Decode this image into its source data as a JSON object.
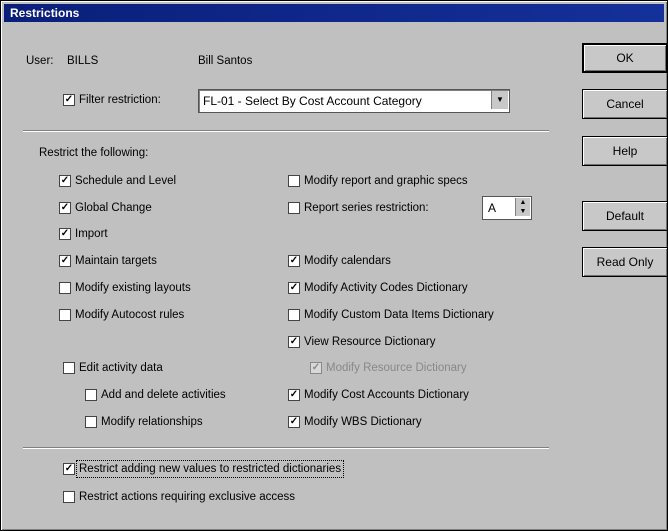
{
  "window": {
    "title": "Restrictions"
  },
  "user": {
    "label": "User:",
    "id": "BILLS",
    "name": "Bill Santos"
  },
  "filter": {
    "label": "Filter restriction:",
    "checked": true,
    "value": "FL-01 - Select By Cost Account Category"
  },
  "restrict_heading": "Restrict the following:",
  "left_checks": [
    {
      "label": "Schedule and Level",
      "checked": true
    },
    {
      "label": "Global Change",
      "checked": true
    },
    {
      "label": "Import",
      "checked": true
    },
    {
      "label": "Maintain targets",
      "checked": true
    },
    {
      "label": "Modify existing layouts",
      "checked": false
    },
    {
      "label": "Modify Autocost rules",
      "checked": false
    },
    {
      "label": "Edit activity data",
      "checked": false
    },
    {
      "label": "Add and delete activities",
      "checked": false
    },
    {
      "label": "Modify relationships",
      "checked": false
    }
  ],
  "right_checks": [
    {
      "label": "Modify report and graphic specs",
      "checked": false
    },
    {
      "label": "Report series restriction:",
      "checked": false
    },
    {
      "label": "Modify calendars",
      "checked": true
    },
    {
      "label": "Modify Activity Codes Dictionary",
      "checked": true
    },
    {
      "label": "Modify Custom Data Items Dictionary",
      "checked": false
    },
    {
      "label": "View Resource Dictionary",
      "checked": true
    },
    {
      "label": "Modify Resource Dictionary",
      "checked": true
    },
    {
      "label": "Modify Cost Accounts Dictionary",
      "checked": true
    },
    {
      "label": "Modify WBS Dictionary",
      "checked": true
    }
  ],
  "report_series_value": "A",
  "bottom_checks": [
    {
      "label": "Restrict adding new values to restricted dictionaries",
      "checked": true
    },
    {
      "label": "Restrict actions requiring exclusive access",
      "checked": false
    }
  ],
  "buttons": {
    "ok": "OK",
    "cancel": "Cancel",
    "help": "Help",
    "default": "Default",
    "read_only": "Read Only"
  },
  "check_mark": "✓",
  "dropdown_arrow": "▼"
}
